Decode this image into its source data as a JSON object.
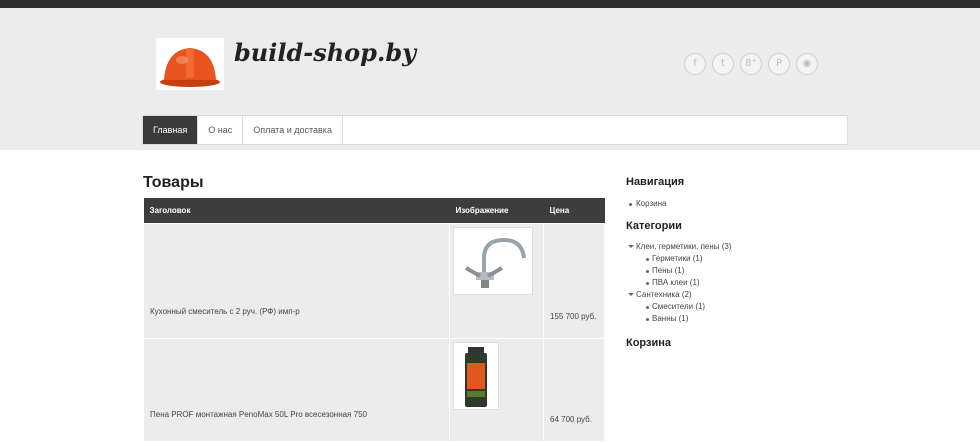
{
  "site": {
    "title": "build-shop.by"
  },
  "social": [
    {
      "icon": "facebook-icon",
      "glyph": "f"
    },
    {
      "icon": "twitter-icon",
      "glyph": "t"
    },
    {
      "icon": "googleplus-icon",
      "glyph": "8⁺"
    },
    {
      "icon": "pinterest-icon",
      "glyph": "P"
    },
    {
      "icon": "rss-icon",
      "glyph": "◉"
    }
  ],
  "nav": {
    "items": [
      {
        "label": "Главная"
      },
      {
        "label": "О нас"
      },
      {
        "label": "Оплата и доставка"
      }
    ]
  },
  "main": {
    "heading": "Товары",
    "table": {
      "headers": [
        "Заголовок",
        "Изображение",
        "Цена"
      ],
      "rows": [
        {
          "name": "Кухонный смеситель с 2 руч. (РФ) имп-р",
          "price": "155 700 руб."
        },
        {
          "name": "Пена PROF монтажная PenoMax 50L Pro всесезонная 750",
          "price": "64 700 руб."
        }
      ]
    }
  },
  "sidebar": {
    "nav_heading": "Навигация",
    "nav_items": [
      "Корзина"
    ],
    "categories_heading": "Категории",
    "categories": [
      {
        "label": "Клеи, герметики, пены (3)",
        "level": 0
      },
      {
        "label": "Герметики (1)",
        "level": 1
      },
      {
        "label": "Пены (1)",
        "level": 1
      },
      {
        "label": "ПВА клеи (1)",
        "level": 1
      },
      {
        "label": "Сантехника (2)",
        "level": 0
      },
      {
        "label": "Смесители (1)",
        "level": 1
      },
      {
        "label": "Ванны (1)",
        "level": 1
      }
    ],
    "cart_heading": "Корзина"
  },
  "colors": {
    "topbar": "#2f2f2f",
    "header_bg": "#ececec",
    "nav_active": "#3a3a3a",
    "table_header": "#3d3d3d",
    "helmet": "#e8531e"
  }
}
